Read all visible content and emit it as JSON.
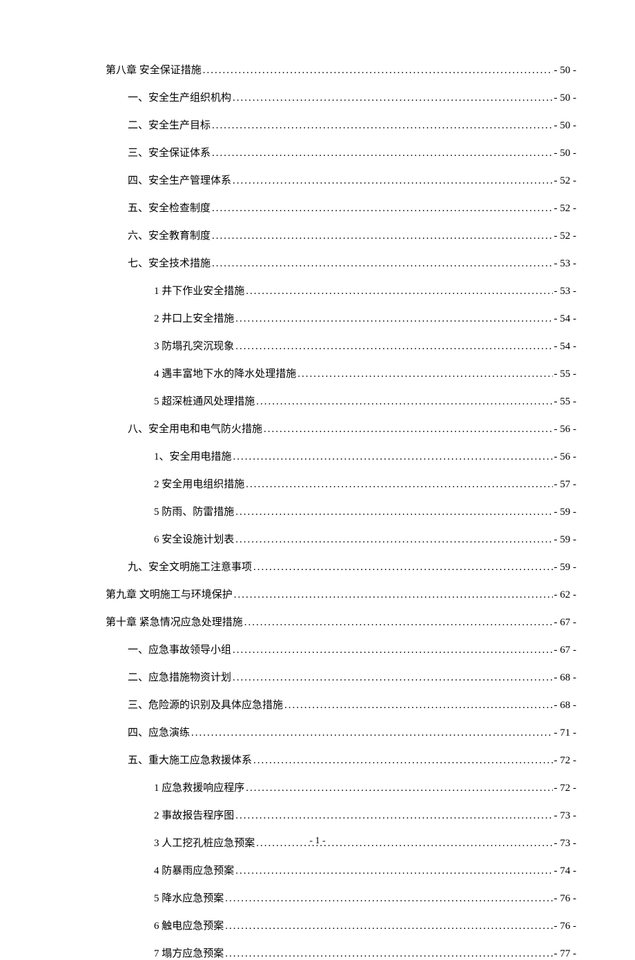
{
  "toc": [
    {
      "indent": 1,
      "label": "第八章   安全保证措施",
      "page": "- 50 -"
    },
    {
      "indent": 2,
      "label": "一、安全生产组织机构",
      "page": "- 50 -"
    },
    {
      "indent": 2,
      "label": "二、安全生产目标",
      "page": "- 50 -"
    },
    {
      "indent": 2,
      "label": "三、安全保证体系",
      "page": "- 50 -"
    },
    {
      "indent": 2,
      "label": "四、安全生产管理体系",
      "page": "- 52 -"
    },
    {
      "indent": 2,
      "label": "五、安全检查制度",
      "page": "- 52 -"
    },
    {
      "indent": 2,
      "label": "六、安全教育制度",
      "page": "- 52 -"
    },
    {
      "indent": 2,
      "label": "七、安全技术措施",
      "page": "- 53 -"
    },
    {
      "indent": 3,
      "label": "1 井下作业安全措施",
      "page": "- 53 -"
    },
    {
      "indent": 3,
      "label": "2 井口上安全措施",
      "page": "- 54 -"
    },
    {
      "indent": 3,
      "label": "3 防塌孔突沉现象",
      "page": "- 54 -"
    },
    {
      "indent": 3,
      "label": "4 遇丰富地下水的降水处理措施",
      "page": "- 55 -"
    },
    {
      "indent": 3,
      "label": "5 超深桩通风处理措施",
      "page": "- 55 -"
    },
    {
      "indent": 2,
      "label": "八、安全用电和电气防火措施",
      "page": "- 56 -"
    },
    {
      "indent": 3,
      "label": "1、安全用电措施",
      "page": "- 56 -"
    },
    {
      "indent": 3,
      "label": "2 安全用电组织措施",
      "page": "- 57 -"
    },
    {
      "indent": 3,
      "label": "5 防雨、防雷措施",
      "page": "- 59 -"
    },
    {
      "indent": 3,
      "label": "6 安全设施计划表",
      "page": "- 59 -"
    },
    {
      "indent": 2,
      "label": "九、安全文明施工注意事项",
      "page": "- 59 -"
    },
    {
      "indent": 1,
      "label": "第九章   文明施工与环境保护",
      "page": "- 62 -"
    },
    {
      "indent": 1,
      "label": "第十章   紧急情况应急处理措施",
      "page": "- 67 -"
    },
    {
      "indent": 2,
      "label": "一、应急事故领导小组",
      "page": "- 67 -"
    },
    {
      "indent": 2,
      "label": "二、应急措施物资计划",
      "page": "- 68 -"
    },
    {
      "indent": 2,
      "label": "三、危险源的识别及具体应急措施",
      "page": "- 68 -"
    },
    {
      "indent": 2,
      "label": "四、应急演练",
      "page": "- 71 -"
    },
    {
      "indent": 2,
      "label": "五、重大施工应急救援体系",
      "page": "- 72 -"
    },
    {
      "indent": 3,
      "label": "1 应急救援响应程序",
      "page": "- 72 -"
    },
    {
      "indent": 3,
      "label": "2 事故报告程序图",
      "page": "- 73 -"
    },
    {
      "indent": 3,
      "label": "3 人工挖孔桩应急预案",
      "page": "- 73 -"
    },
    {
      "indent": 3,
      "label": "4 防暴雨应急预案",
      "page": "- 74 -"
    },
    {
      "indent": 3,
      "label": "5 降水应急预案",
      "page": "- 76 -"
    },
    {
      "indent": 3,
      "label": "6 触电应急预案",
      "page": "- 76 -"
    },
    {
      "indent": 3,
      "label": "7 塌方应急预案",
      "page": "- 77 -"
    }
  ],
  "footer": "- 1 -"
}
